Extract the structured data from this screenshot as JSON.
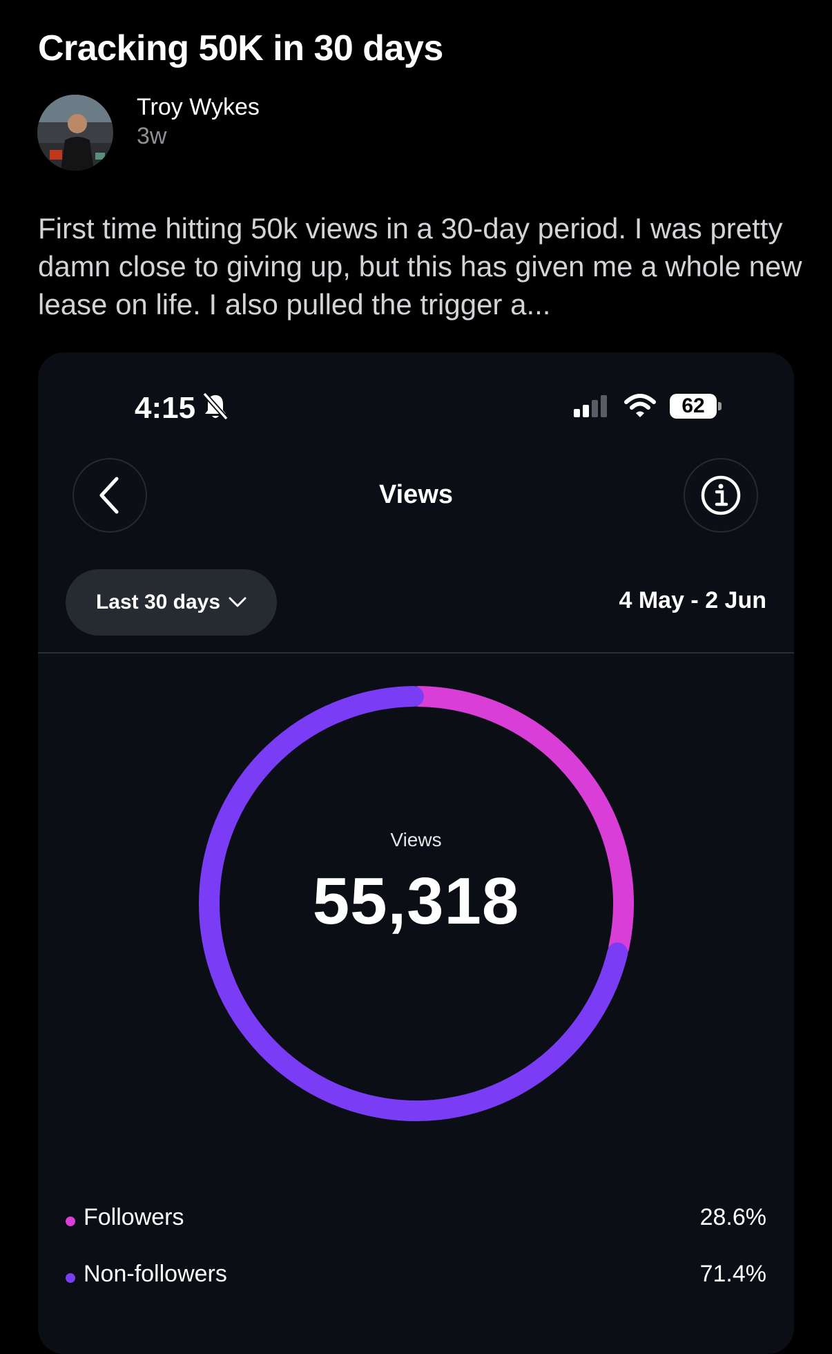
{
  "post": {
    "title": "Cracking 50K in 30 days",
    "author": "Troy Wykes",
    "age": "3w",
    "body": "First time hitting 50k views in a 30-day period. I was pretty damn close to giving up, but this has given me a whole new lease on life. I also pulled the trigger a..."
  },
  "screenshot": {
    "status_bar": {
      "time": "4:15",
      "battery": "62"
    },
    "title": "Views",
    "range_dropdown": "Last 30 days",
    "date_range": "4 May - 2 Jun",
    "center_label": "Views",
    "total_views": "55,318",
    "legend": [
      {
        "label": "Followers",
        "value": "28.6%",
        "color": "#d93fd6"
      },
      {
        "label": "Non-followers",
        "value": "71.4%",
        "color": "#7a3cf5"
      }
    ]
  },
  "chart_data": {
    "type": "pie",
    "title": "Views",
    "categories": [
      "Followers",
      "Non-followers"
    ],
    "values": [
      28.6,
      71.4
    ],
    "colors": [
      "#d93fd6",
      "#7a3cf5"
    ],
    "total": 55318
  },
  "colors": {
    "background": "#000000",
    "card": "#0b0e15",
    "followers": "#d93fd6",
    "non_followers": "#7a3cf5"
  }
}
